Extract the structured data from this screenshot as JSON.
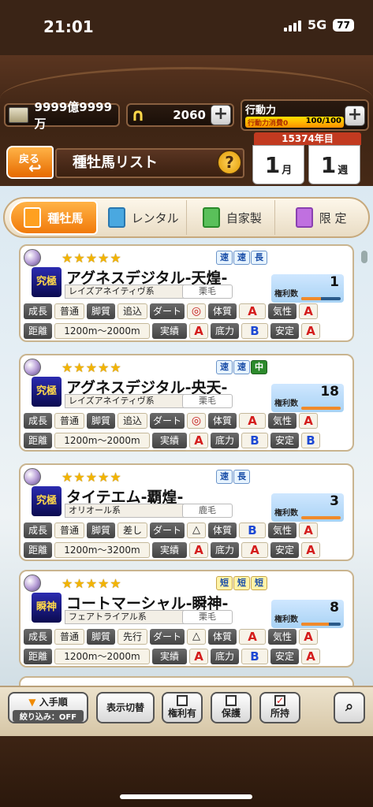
{
  "status": {
    "time": "21:01",
    "network": "5G",
    "battery": "77"
  },
  "resources": {
    "money": "9999億9999万",
    "horseshoe": "2060",
    "action_label": "行動力",
    "action_sub": "行動力消費0",
    "action_value": "100/100"
  },
  "nav": {
    "back_label": "戻る",
    "title": "種牡馬リスト",
    "help": "?"
  },
  "calendar": {
    "year": "15374年目",
    "month_num": "1",
    "month_unit": "月",
    "week_num": "1",
    "week_unit": "週"
  },
  "tabs": [
    {
      "label": "種牡馬",
      "active": true
    },
    {
      "label": "レンタル",
      "active": false
    },
    {
      "label": "自家製",
      "active": false
    },
    {
      "label": "限 定",
      "active": false
    }
  ],
  "stat_labels": {
    "growth": "成長",
    "leg": "脚質",
    "dirt": "ダート",
    "body": "体質",
    "temper": "気性",
    "distance": "距離",
    "record": "実績",
    "stamina": "底力",
    "stability": "安定"
  },
  "rights_label": "権利数",
  "horses": [
    {
      "stars": "★★★★★",
      "portrait": "究極",
      "name": "アグネスデジタル-天煌-",
      "lineage": "レイズアネイティヴ系",
      "coat": "栗毛",
      "tags": [
        "速",
        "速",
        "長"
      ],
      "tag_styles": [
        "t-blue",
        "t-blue",
        "t-blue"
      ],
      "rights": "1",
      "rights_fill": 0.5,
      "growth": "普通",
      "leg": "追込",
      "dirt": "◎",
      "body": "A",
      "temper": "A",
      "distance": "1200m～2000m",
      "record": "A",
      "stamina": "B",
      "stability": "A"
    },
    {
      "stars": "★★★★★",
      "portrait": "究極",
      "name": "アグネスデジタル-央天-",
      "lineage": "レイズアネイティヴ系",
      "coat": "栗毛",
      "tags": [
        "速",
        "速",
        "中"
      ],
      "tag_styles": [
        "t-blue",
        "t-blue",
        "t-green"
      ],
      "rights": "18",
      "rights_fill": 1,
      "growth": "普通",
      "leg": "追込",
      "dirt": "◎",
      "body": "A",
      "temper": "A",
      "distance": "1200m～2000m",
      "record": "A",
      "stamina": "B",
      "stability": "B"
    },
    {
      "stars": "★★★★★",
      "portrait": "究極",
      "name": "タイテエム-覇煌-",
      "lineage": "オリオール系",
      "coat": "鹿毛",
      "tags": [
        "速",
        "長"
      ],
      "tag_styles": [
        "t-blue",
        "t-blue"
      ],
      "rights": "3",
      "rights_fill": 1,
      "growth": "普通",
      "leg": "差し",
      "dirt": "△",
      "body": "B",
      "temper": "A",
      "distance": "1200m～3200m",
      "record": "A",
      "stamina": "A",
      "stability": "A"
    },
    {
      "stars": "★★★★★",
      "portrait": "瞬神",
      "name": "コートマーシャル-瞬神-",
      "lineage": "フェアトライアル系",
      "coat": "栗毛",
      "tags": [
        "短",
        "短",
        "短"
      ],
      "tag_styles": [
        "t-yellow",
        "t-yellow",
        "t-yellow"
      ],
      "rights": "8",
      "rights_fill": 0.7,
      "growth": "普通",
      "leg": "先行",
      "dirt": "△",
      "body": "A",
      "temper": "A",
      "distance": "1200m～2000m",
      "record": "A",
      "stamina": "B",
      "stability": "A"
    }
  ],
  "toolbar": {
    "sort_label": "入手順",
    "filter_label": "絞り込み：OFF",
    "display_label": "表示切替",
    "rights_label": "権利有",
    "protect_label": "保護",
    "owned_label": "所持"
  }
}
